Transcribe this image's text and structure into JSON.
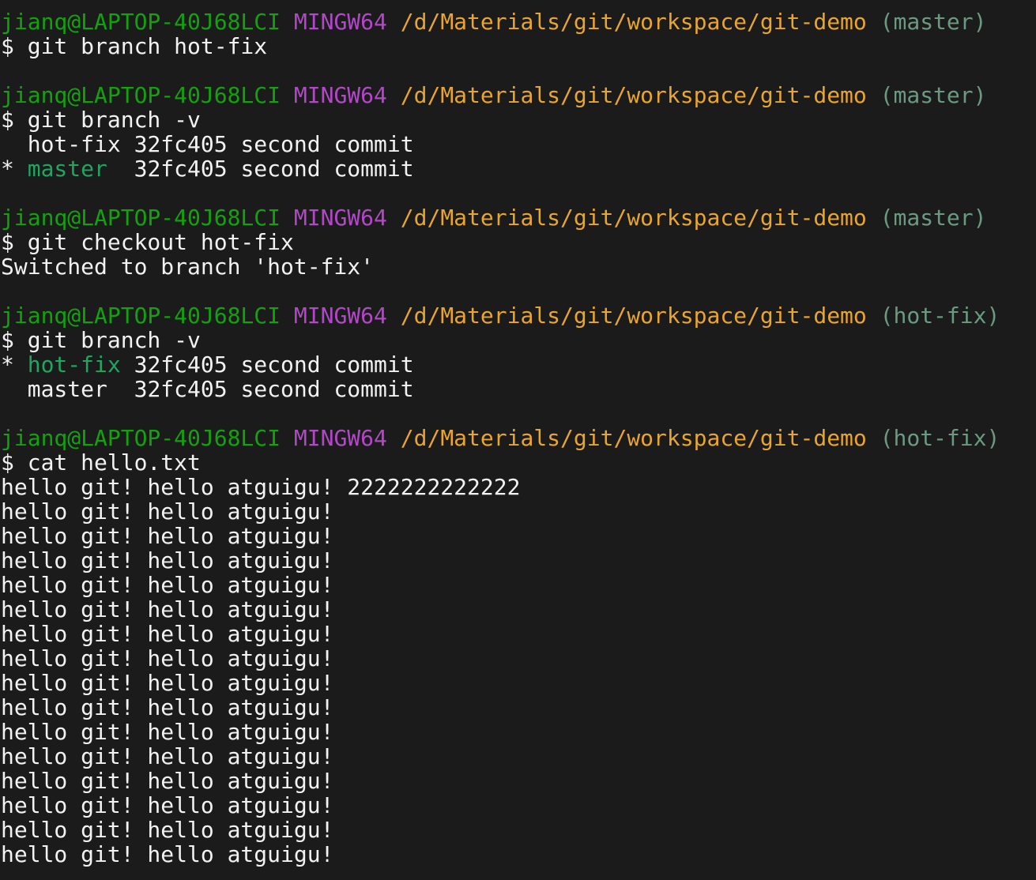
{
  "prompt": {
    "user_host": "jianq@LAPTOP-40J68LCI",
    "system": "MINGW64",
    "path": "/d/Materials/git/workspace/git-demo"
  },
  "colors": {
    "background": "#1b1b1b",
    "text": "#f2f2f2",
    "user_host": "#13a10e",
    "system": "#b148c6",
    "path": "#e8a530",
    "branch_indicator": "#6a9b81",
    "current_branch": "#1fa65f"
  },
  "blocks": [
    {
      "branch_indicator": "(master)",
      "command": "$ git branch hot-fix",
      "output": []
    },
    {
      "branch_indicator": "(master)",
      "command": "$ git branch -v",
      "output": [
        {
          "marker": "  ",
          "name": "hot-fix",
          "rest": " 32fc405 second commit",
          "current": false
        },
        {
          "marker": "* ",
          "name": "master",
          "rest": "  32fc405 second commit",
          "current": true
        }
      ]
    },
    {
      "branch_indicator": "(master)",
      "command": "$ git checkout hot-fix",
      "output": [
        {
          "text": "Switched to branch 'hot-fix'"
        }
      ]
    },
    {
      "branch_indicator": "(hot-fix)",
      "command": "$ git branch -v",
      "output": [
        {
          "marker": "* ",
          "name": "hot-fix",
          "rest": " 32fc405 second commit",
          "current": true
        },
        {
          "marker": "  ",
          "name": "master",
          "rest": "  32fc405 second commit",
          "current": false
        }
      ]
    },
    {
      "branch_indicator": "(hot-fix)",
      "command": "$ cat hello.txt",
      "output": [
        {
          "text": "hello git! hello atguigu! 2222222222222"
        },
        {
          "text": "hello git! hello atguigu!"
        },
        {
          "text": "hello git! hello atguigu!"
        },
        {
          "text": "hello git! hello atguigu!"
        },
        {
          "text": "hello git! hello atguigu!"
        },
        {
          "text": "hello git! hello atguigu!"
        },
        {
          "text": "hello git! hello atguigu!"
        },
        {
          "text": "hello git! hello atguigu!"
        },
        {
          "text": "hello git! hello atguigu!"
        },
        {
          "text": "hello git! hello atguigu!"
        },
        {
          "text": "hello git! hello atguigu!"
        },
        {
          "text": "hello git! hello atguigu!"
        },
        {
          "text": "hello git! hello atguigu!"
        },
        {
          "text": "hello git! hello atguigu!"
        },
        {
          "text": "hello git! hello atguigu!"
        },
        {
          "text": "hello git! hello atguigu!"
        }
      ]
    }
  ]
}
